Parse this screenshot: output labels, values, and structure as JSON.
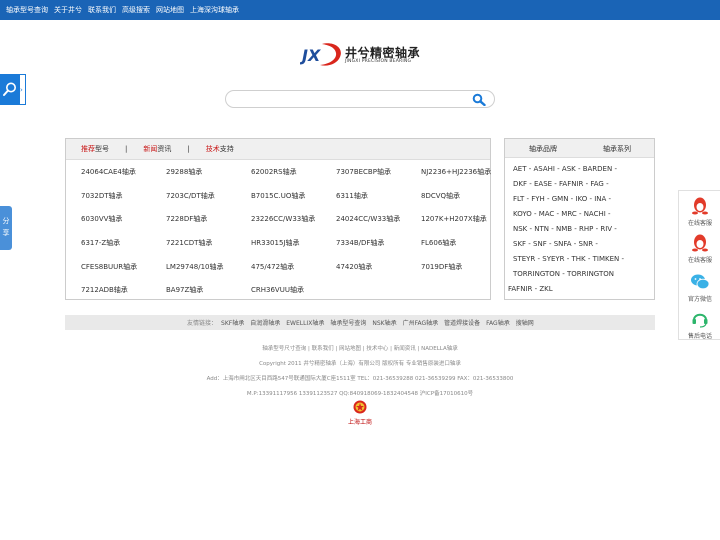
{
  "nav": [
    "轴承型号查询",
    "关于井兮",
    "联系我们",
    "高级搜索",
    "网站地图",
    "上海深沟球轴承"
  ],
  "logo": {
    "cn": "井兮精密轴承",
    "en": "JINGXI PRECISION BEARING",
    "mark": "JX"
  },
  "search": {
    "placeholder": ""
  },
  "left_tab": {
    "arrow": "›"
  },
  "share": {
    "label": "分享"
  },
  "products": {
    "tabs": [
      {
        "red": "推荐",
        "rest": "型号"
      },
      {
        "red": "新闻",
        "rest": "资讯"
      },
      {
        "red": "技术",
        "rest": "支持"
      }
    ],
    "separator": "|",
    "rows": [
      [
        "24064CAE4轴承",
        "29288轴承",
        "62002RS轴承",
        "7307BECBP轴承",
        "NJ2236+HJ2236轴承"
      ],
      [
        "7032DT轴承",
        "7203C/DT轴承",
        "B7015C.UO轴承",
        "6311轴承",
        "8DCVQ轴承"
      ],
      [
        "6030VV轴承",
        "7228DF轴承",
        "23226CC/W33轴承",
        "24024CC/W33轴承",
        "1207K+H207X轴承"
      ],
      [
        "6317-Z轴承",
        "7221CDT轴承",
        "HR33015J轴承",
        "7334B/DF轴承",
        "FL606轴承"
      ],
      [
        "CFES8BUUR轴承",
        "LM29748/10轴承",
        "475/472轴承",
        "47420轴承",
        "7019DF轴承"
      ],
      [
        "7212ADB轴承",
        "BA97Z轴承",
        "CRH36VUU轴承"
      ]
    ]
  },
  "brands": {
    "tab1": "轴承品牌",
    "tab2": "轴承系列",
    "lines": [
      "AET  -  ASAHI  -  ASK  -  BARDEN  -",
      "DKF  -  EASE  -  FAFNIR  -  FAG  -",
      "FLT  -  FYH  -  GMN  -  IKO  -  INA  -",
      "KOYO  -  MAC  -  MRC  -  NACHI  -",
      "NSK  -  NTN  -  NMB  -  RHP  -  RIV  -",
      "SKF  -  SNF  -  SNFA  -  SNR  -",
      "STEYR  -  SYEYR  -  THK  -  TIMKEN  -",
      "TORRINGTON  -  TORRINGTON",
      "FAFNIR  -  ZKL"
    ]
  },
  "links": {
    "label": "友情链接：",
    "items": [
      "SKF轴承",
      "自润滑轴承",
      "EWELLIX轴承",
      "轴承型号查询",
      "NSK轴承",
      "广州FAG轴承",
      "管道焊接设备",
      "FAG轴承",
      "搜轴网"
    ]
  },
  "footer": {
    "links": [
      "轴承型号尺寸查询",
      "联系我们",
      "网站地图",
      "技术中心",
      "新闻资讯",
      "NADELLA轴承"
    ],
    "link_sep": " | ",
    "copyright": "Copyright 2011 井兮精密轴承（上海）有限公司 版权所有 专业销售原装进口轴承",
    "address": "Add：上海市闸北区天目西路547号联通国际大厦C座1511室 TEL：021-36539288 021-36539299  FAX：021-36533800",
    "contact": "M.P:13391117956 13391123527 QQ:840918069-1832404548 沪ICP备17010610号",
    "badge": "上海工商"
  },
  "sidebar": [
    {
      "label": "在线客服",
      "icon": "qq-penguin-icon"
    },
    {
      "label": "在线客服",
      "icon": "qq-penguin-icon"
    },
    {
      "label": "官方微信",
      "icon": "wechat-icon"
    },
    {
      "label": "售后电话",
      "icon": "headset-icon"
    }
  ],
  "colors": {
    "topbar": "#1a64b6",
    "accent_red": "#c81616",
    "search_blue": "#1a7ad8",
    "logo_red": "#d9261c",
    "logo_blue": "#1f4e9c"
  }
}
